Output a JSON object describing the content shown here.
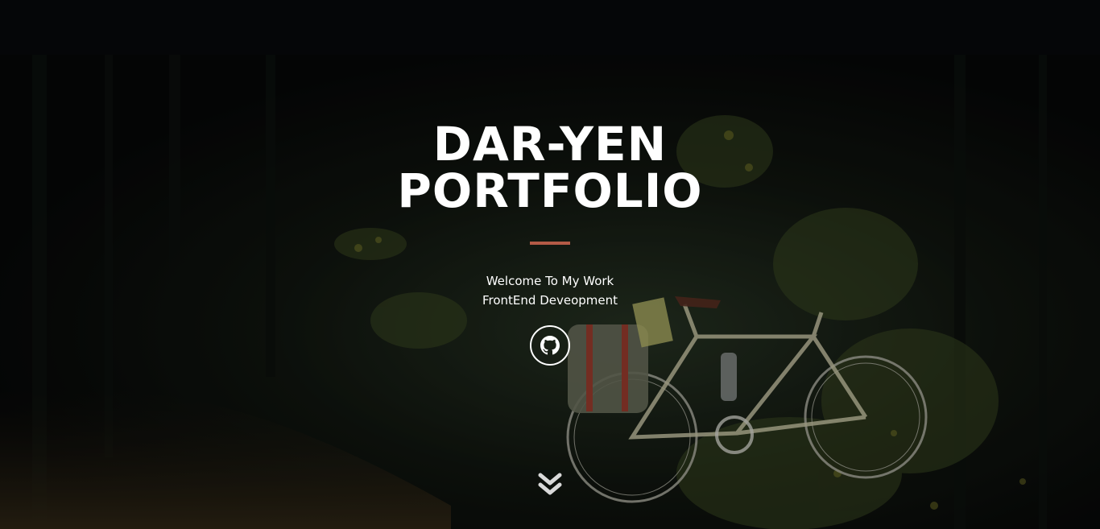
{
  "hero": {
    "title_line1": "DAR-YEN",
    "title_line2": "PORTFOLIO",
    "subtitle_line1": "Welcome To My Work",
    "subtitle_line2": "FrontEnd Deveopment",
    "social": [
      {
        "icon": "github-icon"
      }
    ],
    "scroll_icon": "double-chevron-down-icon"
  },
  "colors": {
    "background": "#050608",
    "accent": "#b35a46",
    "text": "#ffffff"
  }
}
